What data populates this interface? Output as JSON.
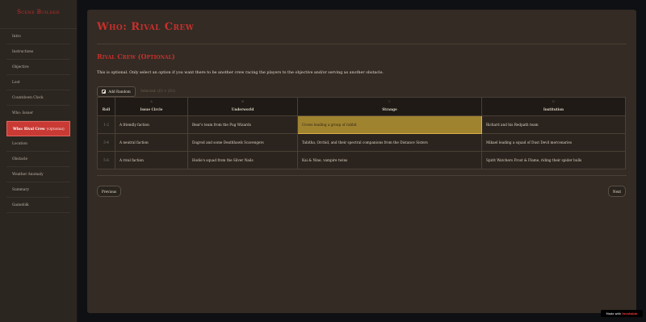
{
  "sidebar": {
    "title": "Scene Builder",
    "items": [
      {
        "label": "Intro",
        "optional": ""
      },
      {
        "label": "Instructions",
        "optional": ""
      },
      {
        "label": "Objective",
        "optional": ""
      },
      {
        "label": "Loot",
        "optional": ""
      },
      {
        "label": "Countdown Clock",
        "optional": ""
      },
      {
        "label": "Who: Issuer",
        "optional": ""
      },
      {
        "label": "Who: Rival Crew",
        "optional": "(Optional)"
      },
      {
        "label": "Location",
        "optional": ""
      },
      {
        "label": "Obstacle",
        "optional": ""
      },
      {
        "label": "Weather Anomaly",
        "optional": ""
      },
      {
        "label": "Summary",
        "optional": ""
      },
      {
        "label": "Gamefolk",
        "optional": ""
      }
    ]
  },
  "main": {
    "title": "Who: Rival Crew",
    "section_title": "Rival Crew (Optional)",
    "description": "This is optional. Only select an option if you want there to be another crew racing the players to the objective and/or serving as another obstacle.",
    "add_button_label": "Add Random",
    "add_hint": "Selected: (D) + (D1)",
    "table": {
      "columns": [
        {
          "letter": "",
          "label": "Roll"
        },
        {
          "letter": "A",
          "label": "Issue Circle"
        },
        {
          "letter": "B",
          "label": "Underworld"
        },
        {
          "letter": "C",
          "label": "Strange"
        },
        {
          "letter": "D",
          "label": "Institution"
        }
      ],
      "rows": [
        {
          "roll": "1-2",
          "cells": [
            "A friendly faction",
            "Bear's team from the Pug Wizards",
            "Crows leading a group of rabbit",
            "Richard and his Redpath team"
          ]
        },
        {
          "roll": "3-4",
          "cells": [
            "A neutral faction",
            "Dagrod and some Deathhawk Scavengers",
            "Tabitha, Orchid, and their spectral companions from the Distance Sisters",
            "Mikael leading a squad of Dust Devil mercenaries"
          ]
        },
        {
          "roll": "5-6",
          "cells": [
            "A rival faction",
            "Hodie's squad from the Silver Nails",
            "Kai & Nine, vampire twins",
            "Spirit Watchers Frost & Flame, riding their spider bulls"
          ]
        }
      ]
    },
    "previous_label": "Previous",
    "next_label": "Next"
  },
  "watermark": {
    "prefix": "Made with",
    "brand": "Invotable"
  },
  "colors": {
    "accent": "#c7302c",
    "active_bg": "#c93a34",
    "selected_cell": "#a0832f",
    "panel_bg": "#332b24",
    "sidebar_bg": "#2c2621"
  }
}
